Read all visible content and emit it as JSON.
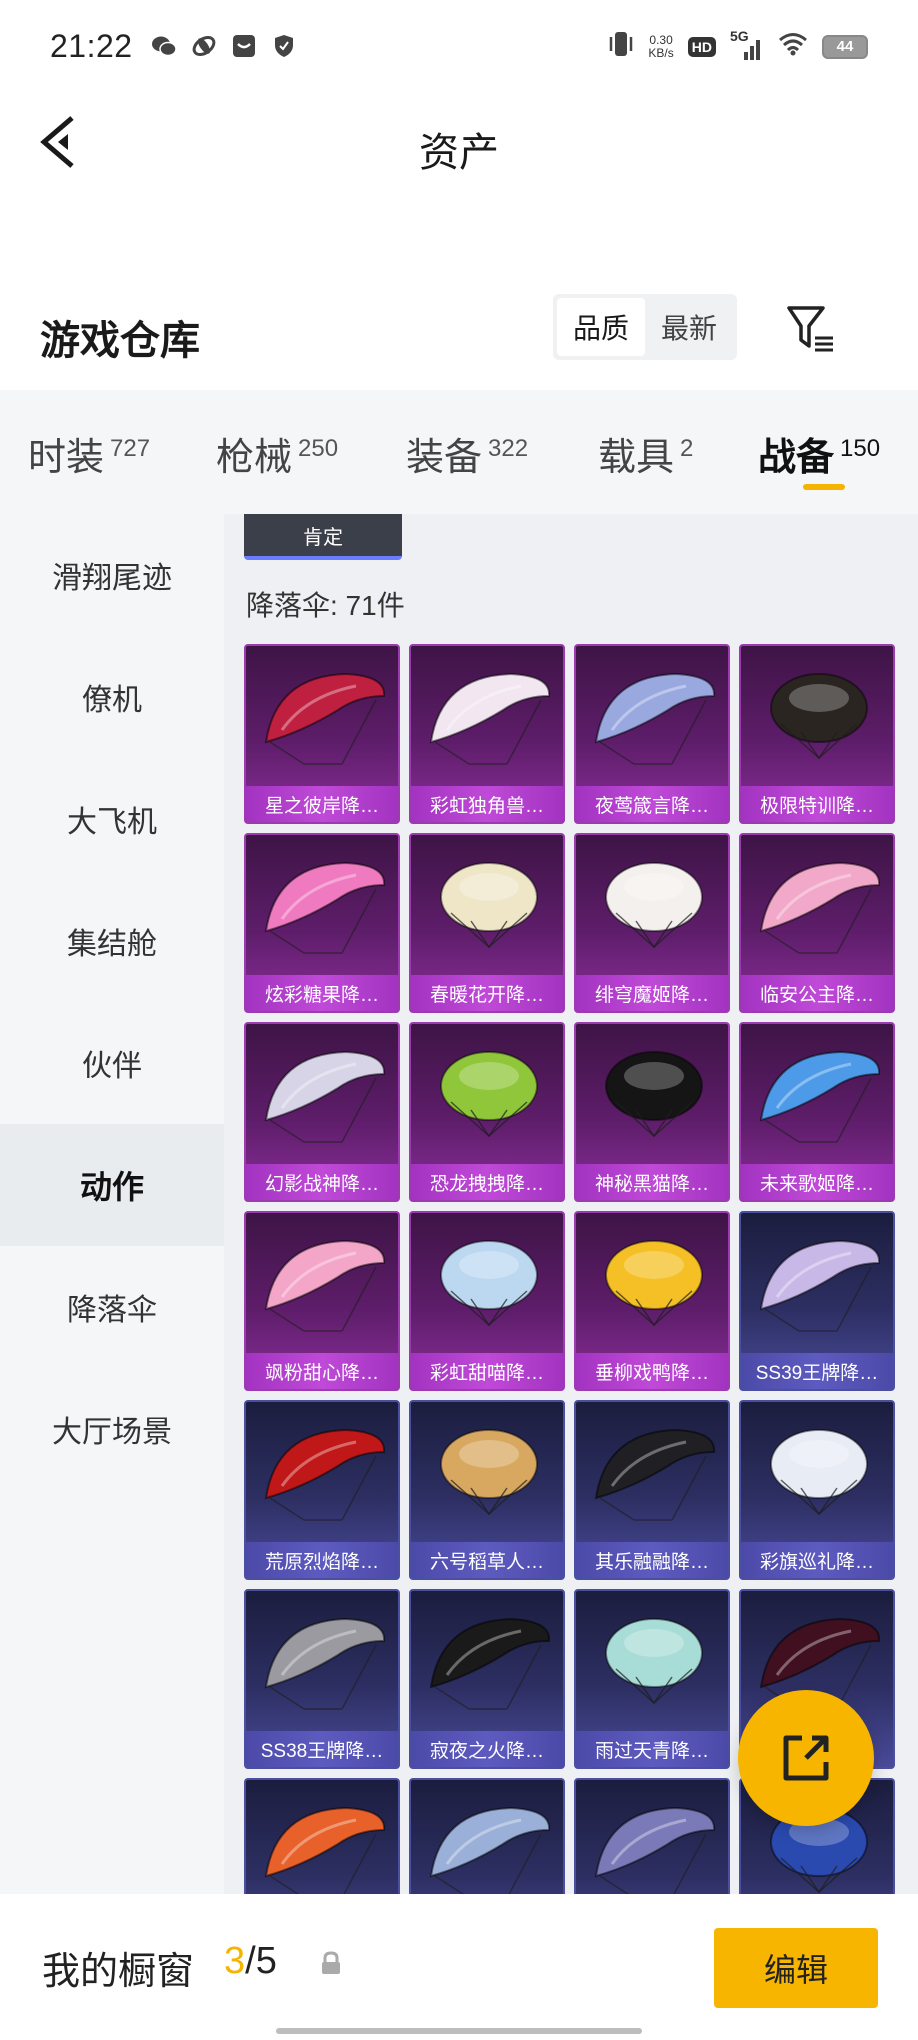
{
  "status_bar": {
    "time": "21:22",
    "net_speed_value": "0.30",
    "net_speed_unit": "KB/s",
    "hd_label": "HD",
    "signal_label": "5G",
    "battery": "44"
  },
  "header": {
    "title": "资产"
  },
  "warehouse": {
    "title": "游戏仓库",
    "sort_options": [
      "品质",
      "最新"
    ],
    "active_sort": "品质"
  },
  "category_tabs": [
    {
      "label": "时装",
      "count": "727"
    },
    {
      "label": "枪械",
      "count": "250"
    },
    {
      "label": "装备",
      "count": "322"
    },
    {
      "label": "载具",
      "count": "2"
    },
    {
      "label": "战备",
      "count": "150",
      "active": true
    }
  ],
  "sub_nav": [
    {
      "label": "滑翔尾迹"
    },
    {
      "label": "僚机"
    },
    {
      "label": "大飞机"
    },
    {
      "label": "集结舱"
    },
    {
      "label": "伙伴"
    },
    {
      "label": "动作",
      "active": true
    },
    {
      "label": "降落伞"
    },
    {
      "label": "大厅场景"
    }
  ],
  "content": {
    "confirm_label": "肯定",
    "count_label": "降落伞: 71件"
  },
  "items": [
    {
      "name": "星之彼岸降…",
      "tier": "purple",
      "art": "red-black-canopy",
      "color": "#c02040"
    },
    {
      "name": "彩虹独角兽…",
      "tier": "purple",
      "art": "white-pink-canopy",
      "color": "#f2e6f0"
    },
    {
      "name": "夜莺箴言降…",
      "tier": "purple",
      "art": "ornate-blue-canopy",
      "color": "#9aa8e0"
    },
    {
      "name": "极限特训降…",
      "tier": "purple",
      "art": "black-gold-dome",
      "color": "#2a2520"
    },
    {
      "name": "炫彩糖果降…",
      "tier": "purple",
      "art": "candy-canopy",
      "color": "#f07ac0"
    },
    {
      "name": "春暖花开降…",
      "tier": "purple",
      "art": "flower-dome",
      "color": "#efe6c8"
    },
    {
      "name": "绯穹魔姬降…",
      "tier": "purple",
      "art": "cat-dome",
      "color": "#f4f0ee"
    },
    {
      "name": "临安公主降…",
      "tier": "purple",
      "art": "pink-canopy",
      "color": "#f2a8c8"
    },
    {
      "name": "幻影战神降…",
      "tier": "purple",
      "art": "silver-canopy",
      "color": "#d8d4e8"
    },
    {
      "name": "恐龙拽拽降…",
      "tier": "purple",
      "art": "green-square",
      "color": "#8fc63a"
    },
    {
      "name": "神秘黑猫降…",
      "tier": "purple",
      "art": "black-cat-head",
      "color": "#151515"
    },
    {
      "name": "未来歌姬降…",
      "tier": "purple",
      "art": "blue-white-canopy",
      "color": "#4c9ae8"
    },
    {
      "name": "飒粉甜心降…",
      "tier": "purple",
      "art": "pink-heart-canopy",
      "color": "#f4a6c8"
    },
    {
      "name": "彩虹甜喵降…",
      "tier": "purple",
      "art": "pastel-dome",
      "color": "#bcd8f0"
    },
    {
      "name": "垂柳戏鸭降…",
      "tier": "purple",
      "art": "duck-dome",
      "color": "#f5c025"
    },
    {
      "name": "SS39王牌降…",
      "tier": "blue",
      "art": "lavender-canopy",
      "color": "#c8b8e8"
    },
    {
      "name": "荒原烈焰降…",
      "tier": "blue",
      "art": "red-flame-canopy",
      "color": "#c01818"
    },
    {
      "name": "六号稻草人…",
      "tier": "blue",
      "art": "panda-dome",
      "color": "#d8a860"
    },
    {
      "name": "其乐融融降…",
      "tier": "blue",
      "art": "dark-gold-canopy",
      "color": "#202024"
    },
    {
      "name": "彩旗巡礼降…",
      "tier": "blue",
      "art": "white-blue-dome",
      "color": "#e8ecf4"
    },
    {
      "name": "SS38王牌降…",
      "tier": "blue",
      "art": "grey-web-canopy",
      "color": "#9a9aa0"
    },
    {
      "name": "寂夜之火降…",
      "tier": "blue",
      "art": "black-yellow-canopy",
      "color": "#1a1a1a"
    },
    {
      "name": "雨过天青降…",
      "tier": "blue",
      "art": "teal-dome",
      "color": "#a8dcd6"
    },
    {
      "name": "",
      "tier": "blue",
      "art": "dark-red-canopy",
      "color": "#401020"
    },
    {
      "name": "",
      "tier": "blue",
      "art": "orange-canopy",
      "color": "#e8602a"
    },
    {
      "name": "",
      "tier": "blue",
      "art": "555-canopy",
      "color": "#9ab0d8"
    },
    {
      "name": "",
      "tier": "blue",
      "art": "checker-canopy",
      "color": "#7a7ab8"
    },
    {
      "name": "",
      "tier": "blue",
      "art": "blue-dome",
      "color": "#2a4ab0"
    }
  ],
  "bottom_bar": {
    "showcase_label": "我的橱窗",
    "showcase_current": "3",
    "showcase_sep": "/",
    "showcase_total": "5",
    "edit_label": "编辑"
  },
  "colors": {
    "accent": "#f7b500",
    "purple_tier": "#9c3ab0",
    "blue_tier": "#4a4fa0"
  }
}
